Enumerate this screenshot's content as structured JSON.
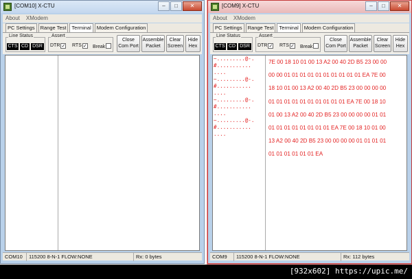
{
  "left_window": {
    "title": "[COM10] X-CTU",
    "menu": [
      "About",
      "XModem"
    ],
    "tabs": [
      "PC Settings",
      "Range Test",
      "Terminal",
      "Modem Configuration"
    ],
    "active_tab": "Terminal",
    "line_status_label": "Line Status",
    "indicators": [
      "CTS",
      "CD",
      "DSR"
    ],
    "assert_label": "Assert",
    "dtr_label": "DTR",
    "rts_label": "RTS",
    "break_label": "Break",
    "buttons": {
      "close_port": "Close\nCom Port",
      "assemble": "Assemble\nPacket",
      "clear": "Clear\nScreen",
      "hide_hex": "Hide\nHex"
    },
    "status": {
      "port": "COM10",
      "settings": "115200 8-N-1  FLOW:NONE",
      "rx": "Rx: 0 bytes"
    }
  },
  "right_window": {
    "title": "[COM9] X-CTU",
    "menu": [
      "About",
      "XModem"
    ],
    "tabs": [
      "PC Settings",
      "Range Test",
      "Terminal",
      "Modem Configuration"
    ],
    "active_tab": "Terminal",
    "line_status_label": "Line Status",
    "indicators": [
      "CTS",
      "CD",
      "DSR"
    ],
    "assert_label": "Assert",
    "dtr_label": "DTR",
    "rts_label": "RTS",
    "break_label": "Break",
    "buttons": {
      "close_port": "Close\nCom Port",
      "assemble": "Assemble\nPacket",
      "clear": "Clear\nScreen",
      "hide_hex": "Hide\nHex"
    },
    "ascii_lines": [
      "~.........@-.",
      "#...........",
      "....",
      "~.........@-.",
      "#...........",
      "....",
      "~.........@-.",
      "#...........",
      "....",
      "~.........@-.",
      "#...........",
      "...."
    ],
    "hex_lines": [
      "7E 00 18 10 01 00 13 A2 00 40 2D B5 23 00 00",
      "00 00 01 01 01 01 01 01 01 01 01 01 EA 7E 00",
      "18 10 01 00 13 A2 00 40 2D B5 23 00 00 00 00",
      "01 01 01 01 01 01 01 01 01 01 EA 7E 00 18 10",
      "01 00 13 A2 00 40 2D B5 23 00 00 00 00 01 01",
      "01 01 01 01 01 01 01 01 EA 7E 00 18 10 01 00",
      "13 A2 00 40 2D B5 23 00 00 00 00 01 01 01 01",
      "01 01 01 01 01 01 EA"
    ],
    "status": {
      "port": "COM9",
      "settings": "115200 8-N-1  FLOW:NONE",
      "rx": "Rx: 112 bytes"
    }
  },
  "caption": "[932x602] https://upic.me/",
  "colors": {
    "terminal_text": "#e32020",
    "active_window_border": "#c43a3a"
  },
  "checkbox_mark": "✓",
  "window_controls": {
    "minimize": "–",
    "maximize": "□",
    "close": "✕"
  }
}
